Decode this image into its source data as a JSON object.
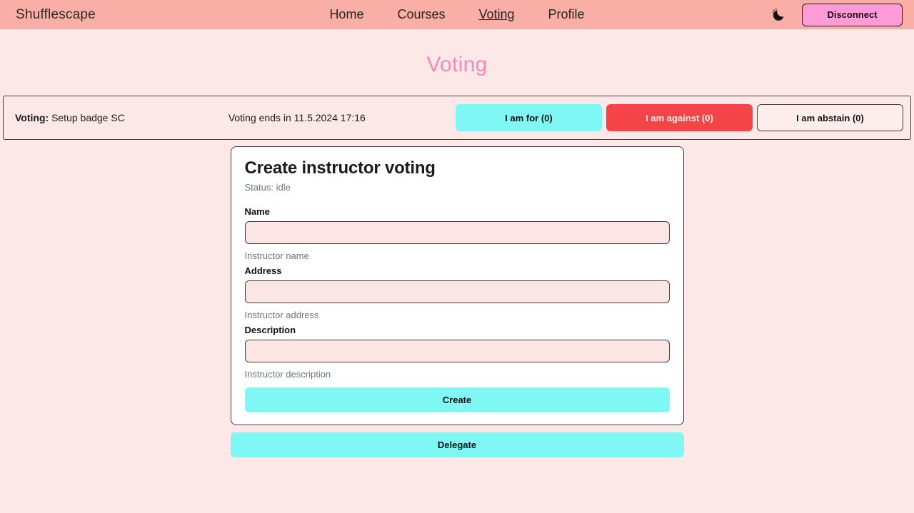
{
  "navbar": {
    "brand": "Shufflescape",
    "links": [
      {
        "label": "Home",
        "active": false
      },
      {
        "label": "Courses",
        "active": false
      },
      {
        "label": "Voting",
        "active": true
      },
      {
        "label": "Profile",
        "active": false
      }
    ],
    "theme_toggle_icon": "moon-stars-icon",
    "disconnect_label": "Disconnect",
    "colors": {
      "bar_background": "#f9afa5",
      "disconnect_background": "#ff9bd9"
    }
  },
  "page": {
    "title": "Voting",
    "title_color": "#f489b9",
    "background": "#fce8e6"
  },
  "voting_bar": {
    "label_prefix": "Voting:",
    "subject": "Setup badge SC",
    "deadline": "Voting ends in 11.5.2024 17:16",
    "buttons": [
      {
        "label": "I am for (0)",
        "style": "for",
        "color": "#7ff7f5"
      },
      {
        "label": "I am against (0)",
        "style": "against",
        "color": "#f44448"
      },
      {
        "label": "I am abstain (0)",
        "style": "abstain",
        "color": "#fdeeec"
      }
    ]
  },
  "card": {
    "title": "Create instructor voting",
    "status": "Status: idle",
    "fields": [
      {
        "label": "Name",
        "value": "",
        "placeholder": "",
        "help": "Instructor name"
      },
      {
        "label": "Address",
        "value": "",
        "placeholder": "",
        "help": "Instructor address"
      },
      {
        "label": "Description",
        "value": "",
        "placeholder": "",
        "help": "Instructor description"
      }
    ],
    "submit_label": "Create"
  },
  "delegate": {
    "label": "Delegate"
  }
}
